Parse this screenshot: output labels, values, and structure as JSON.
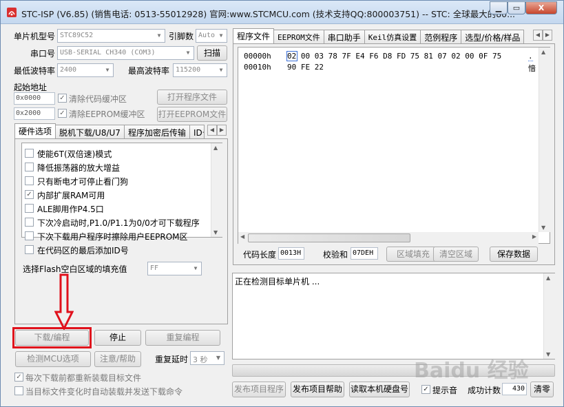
{
  "window": {
    "title": "STC-ISP (V6.85) (销售电话: 0513-55012928) 官网:www.STCMCU.com  (技术支持QQ:800003751)  -- STC: 全球最大的80...",
    "min_label": "▁",
    "max_label": "▭",
    "close_label": "X"
  },
  "left": {
    "mcu_label": "单片机型号",
    "mcu_value": "STC89C52",
    "pins_label": "引脚数",
    "pins_value": "Auto",
    "port_label": "串口号",
    "port_value": "USB-SERIAL CH340 (COM3)",
    "scan_button": "扫描",
    "min_baud_label": "最低波特率",
    "min_baud_value": "2400",
    "max_baud_label": "最高波特率",
    "max_baud_value": "115200",
    "start_addr_label": "起始地址",
    "addr1_prefix": "0x",
    "addr1_value": "0000",
    "clear_code_label": "清除代码缓冲区",
    "open_prog_button": "打开程序文件",
    "addr2_prefix": "0x",
    "addr2_value": "2000",
    "clear_eeprom_label": "清除EEPROM缓冲区",
    "open_eeprom_button": "打开EEPROM文件",
    "tabs": [
      "硬件选项",
      "脱机下载/U8/U7",
      "程序加密后传输",
      "ID号"
    ],
    "options": [
      {
        "label": "使能6T(双倍速)模式",
        "checked": false
      },
      {
        "label": "降低振荡器的放大增益",
        "checked": false
      },
      {
        "label": "只有断电才可停止看门狗",
        "checked": false
      },
      {
        "label": "内部扩展RAM可用",
        "checked": true
      },
      {
        "label": "ALE脚用作P4.5口",
        "checked": false
      },
      {
        "label": "下次冷启动时,P1.0/P1.1为0/0才可下载程序",
        "checked": false
      },
      {
        "label": "下次下载用户程序时擦除用户EEPROM区",
        "checked": false
      },
      {
        "label": "在代码区的最后添加ID号",
        "checked": false
      }
    ],
    "fill_label": "选择Flash空白区域的填充值",
    "fill_value": "FF",
    "download_button": "下载/编程",
    "stop_button": "停止",
    "reprogram_button": "重复编程",
    "detect_button": "检测MCU选项",
    "help_button": "注意/帮助",
    "delay_label": "重复延时",
    "delay_value": "3 秒",
    "reload_label": "每次下载前都重新装载目标文件",
    "reload_checked": true,
    "auto_label": "当目标文件变化时自动装载并发送下载命令",
    "auto_checked": false
  },
  "right": {
    "tabs": [
      "程序文件",
      "EEPROM文件",
      "串口助手",
      "Keil仿真设置",
      "范例程序",
      "选型/价格/样品"
    ],
    "hex_rows": [
      {
        "addr": "00000h",
        "bytes": "02 00 03 78 7F E4 F6 D8 FD 75 81 07 02 00 0F 75",
        "ascii": "."
      },
      {
        "addr": "00010h",
        "bytes": "90 FE 22",
        "ascii": "愔"
      }
    ],
    "code_len_label": "代码长度",
    "code_len_value": "0013H",
    "checksum_label": "校验和",
    "checksum_value": "07DEH",
    "fill_area_button": "区域填充",
    "clear_area_button": "清空区域",
    "save_button": "保存数据",
    "status_text": "正在检测目标单片机 ...",
    "publish_button": "发布项目程序",
    "publish_help_button": "发布项目帮助",
    "read_disk_button": "读取本机硬盘号",
    "prompt_label": "提示音",
    "prompt_checked": true,
    "success_label": "成功计数",
    "success_value": "430",
    "clear_button": "清零"
  },
  "watermark": "Baidu 经验"
}
